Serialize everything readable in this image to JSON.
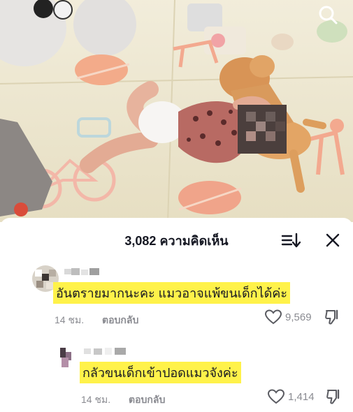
{
  "header": {
    "comment_count": "3,082",
    "comment_label": "ความคิดเห็น"
  },
  "icons": {
    "search": "search-icon",
    "sort": "sort-icon",
    "close": "close-icon",
    "like": "heart-outline-icon",
    "dislike": "thumbs-down-icon"
  },
  "comments": [
    {
      "text": "อันตรายมากนะคะ แมวอาจแพ้ขนเด็กได้ค่ะ",
      "time": "14 ชม.",
      "reply_label": "ตอบกลับ",
      "likes": "9,569"
    },
    {
      "text": "กลัวขนเด็กเข้าปอดแมวจังค่ะ",
      "time": "14 ชม.",
      "reply_label": "ตอบกลับ",
      "likes": "1,414"
    }
  ],
  "colors": {
    "highlight": "#fff24a",
    "muted_text": "#8a8b91",
    "primary_text": "#161823"
  }
}
